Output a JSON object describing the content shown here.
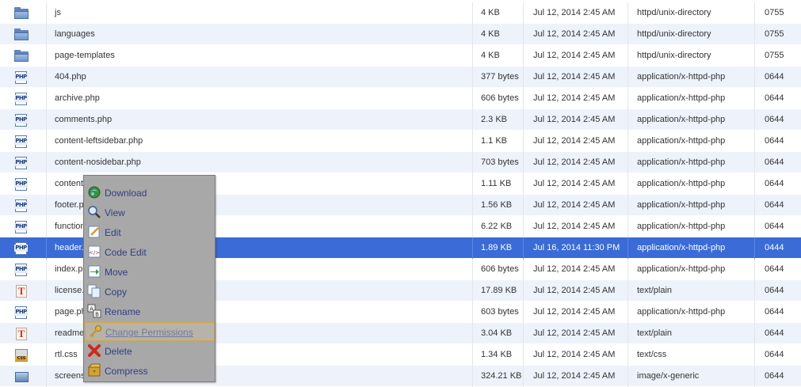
{
  "files": [
    {
      "name": "js",
      "icon": "folder-icon",
      "size": "4 KB",
      "date": "Jul 12, 2014 2:45 AM",
      "type": "httpd/unix-directory",
      "perms": "0755"
    },
    {
      "name": "languages",
      "icon": "folder-icon",
      "size": "4 KB",
      "date": "Jul 12, 2014 2:45 AM",
      "type": "httpd/unix-directory",
      "perms": "0755"
    },
    {
      "name": "page-templates",
      "icon": "folder-icon",
      "size": "4 KB",
      "date": "Jul 12, 2014 2:45 AM",
      "type": "httpd/unix-directory",
      "perms": "0755"
    },
    {
      "name": "404.php",
      "icon": "php-file-icon",
      "size": "377 bytes",
      "date": "Jul 12, 2014 2:45 AM",
      "type": "application/x-httpd-php",
      "perms": "0644"
    },
    {
      "name": "archive.php",
      "icon": "php-file-icon",
      "size": "606 bytes",
      "date": "Jul 12, 2014 2:45 AM",
      "type": "application/x-httpd-php",
      "perms": "0644"
    },
    {
      "name": "comments.php",
      "icon": "php-file-icon",
      "size": "2.3 KB",
      "date": "Jul 12, 2014 2:45 AM",
      "type": "application/x-httpd-php",
      "perms": "0644"
    },
    {
      "name": "content-leftsidebar.php",
      "icon": "php-file-icon",
      "size": "1.1 KB",
      "date": "Jul 12, 2014 2:45 AM",
      "type": "application/x-httpd-php",
      "perms": "0644"
    },
    {
      "name": "content-nosidebar.php",
      "icon": "php-file-icon",
      "size": "703 bytes",
      "date": "Jul 12, 2014 2:45 AM",
      "type": "application/x-httpd-php",
      "perms": "0644"
    },
    {
      "name": "content",
      "icon": "php-file-icon",
      "size": "1.11 KB",
      "date": "Jul 12, 2014 2:45 AM",
      "type": "application/x-httpd-php",
      "perms": "0644"
    },
    {
      "name": "footer.p",
      "icon": "php-file-icon",
      "size": "1.56 KB",
      "date": "Jul 12, 2014 2:45 AM",
      "type": "application/x-httpd-php",
      "perms": "0644"
    },
    {
      "name": "function",
      "icon": "php-file-icon",
      "size": "6.22 KB",
      "date": "Jul 12, 2014 2:45 AM",
      "type": "application/x-httpd-php",
      "perms": "0644"
    },
    {
      "name": "header.",
      "icon": "php-file-icon",
      "size": "1.89 KB",
      "date": "Jul 16, 2014 11:30 PM",
      "type": "application/x-httpd-php",
      "perms": "0444",
      "selected": true
    },
    {
      "name": "index.ph",
      "icon": "php-file-icon",
      "size": "606 bytes",
      "date": "Jul 12, 2014 2:45 AM",
      "type": "application/x-httpd-php",
      "perms": "0644"
    },
    {
      "name": "license.",
      "icon": "text-file-icon",
      "size": "17.89 KB",
      "date": "Jul 12, 2014 2:45 AM",
      "type": "text/plain",
      "perms": "0644"
    },
    {
      "name": "page.ph",
      "icon": "php-file-icon",
      "size": "603 bytes",
      "date": "Jul 12, 2014 2:45 AM",
      "type": "application/x-httpd-php",
      "perms": "0644"
    },
    {
      "name": "readme",
      "icon": "text-file-icon",
      "size": "3.04 KB",
      "date": "Jul 12, 2014 2:45 AM",
      "type": "text/plain",
      "perms": "0644"
    },
    {
      "name": "rtl.css",
      "icon": "css-file-icon",
      "size": "1.34 KB",
      "date": "Jul 12, 2014 2:45 AM",
      "type": "text/css",
      "perms": "0644"
    },
    {
      "name": "screens",
      "icon": "image-file-icon",
      "size": "324.21 KB",
      "date": "Jul 12, 2014 2:45 AM",
      "type": "image/x-generic",
      "perms": "0644"
    }
  ],
  "context_menu": {
    "items": [
      {
        "label": "Download",
        "icon": "download-icon"
      },
      {
        "label": "View",
        "icon": "view-icon"
      },
      {
        "label": "Edit",
        "icon": "edit-icon"
      },
      {
        "label": "Code Edit",
        "icon": "code-edit-icon"
      },
      {
        "label": "Move",
        "icon": "move-icon"
      },
      {
        "label": "Copy",
        "icon": "copy-icon"
      },
      {
        "label": "Rename",
        "icon": "rename-icon"
      },
      {
        "label": "Change Permissions",
        "icon": "key-icon",
        "highlighted": true
      },
      {
        "label": "Delete",
        "icon": "delete-icon"
      },
      {
        "label": "Compress",
        "icon": "compress-icon"
      }
    ]
  },
  "colors": {
    "selected_row": "#3a6bd6",
    "alt_row": "#eef3fb",
    "menu_bg": "#a8a8a8",
    "menu_text": "#2e3f86",
    "highlight_border": "#d4a542"
  }
}
